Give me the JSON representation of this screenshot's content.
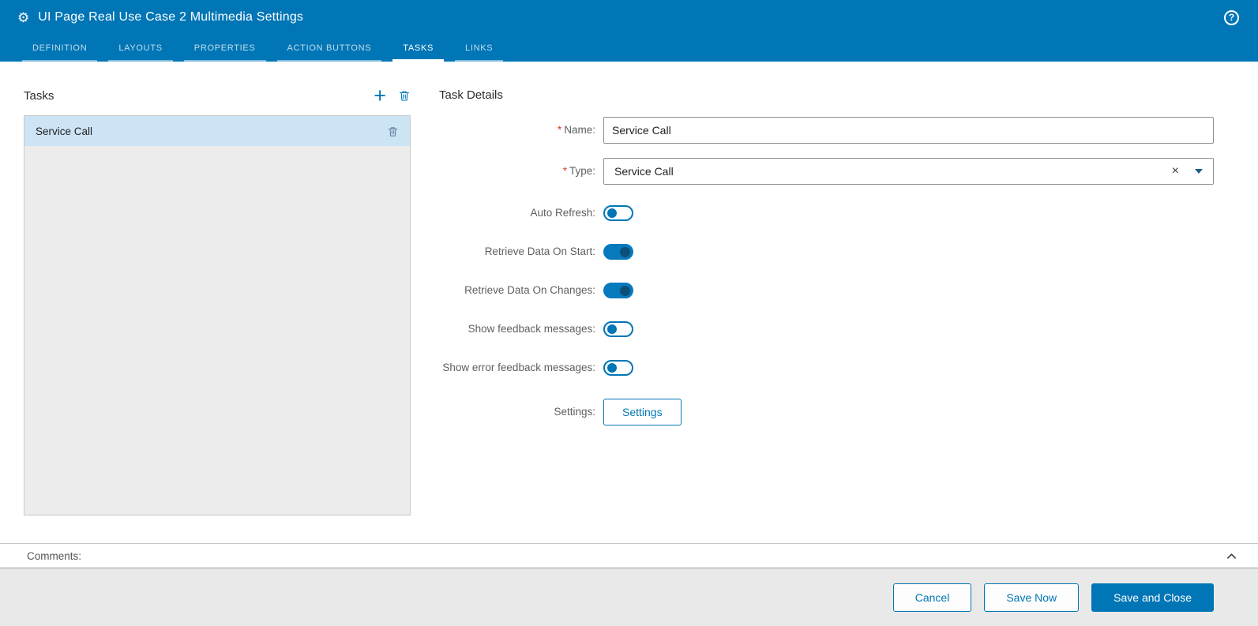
{
  "colors": {
    "header_bar": "#0076b6",
    "accent": "#0076b6",
    "selected_item_bg": "#cde4f4",
    "required_marker": "#d9411e",
    "footer_bg": "#e9e9e9"
  },
  "icons": {
    "gear": "⚙",
    "help": "?",
    "add": "+",
    "clear": "×"
  },
  "header": {
    "title": "UI Page Real Use Case 2 Multimedia Settings",
    "tabs": [
      {
        "label": "DEFINITION"
      },
      {
        "label": "LAYOUTS"
      },
      {
        "label": "PROPERTIES"
      },
      {
        "label": "ACTION BUTTONS"
      },
      {
        "label": "TASKS"
      },
      {
        "label": "LINKS"
      }
    ],
    "active_tab": "TASKS"
  },
  "tasks_panel": {
    "title": "Tasks",
    "items": [
      {
        "label": "Service Call",
        "selected": true
      }
    ]
  },
  "details": {
    "title": "Task Details",
    "name": {
      "required": "*",
      "label": "Name:",
      "value": "Service Call"
    },
    "type": {
      "required": "*",
      "label": "Type:",
      "value": "Service Call"
    },
    "auto_refresh": {
      "label": "Auto Refresh:",
      "on": false
    },
    "retrieve_on_start": {
      "label": "Retrieve Data On Start:",
      "on": true
    },
    "retrieve_on_changes": {
      "label": "Retrieve Data On Changes:",
      "on": true
    },
    "show_feedback": {
      "label": "Show feedback messages:",
      "on": false
    },
    "show_error_feedback": {
      "label": "Show error feedback messages:",
      "on": false
    },
    "settings": {
      "label": "Settings:",
      "button_label": "Settings"
    }
  },
  "comments": {
    "label": "Comments:"
  },
  "footer": {
    "cancel": "Cancel",
    "save_now": "Save Now",
    "save_and_close": "Save and Close"
  }
}
